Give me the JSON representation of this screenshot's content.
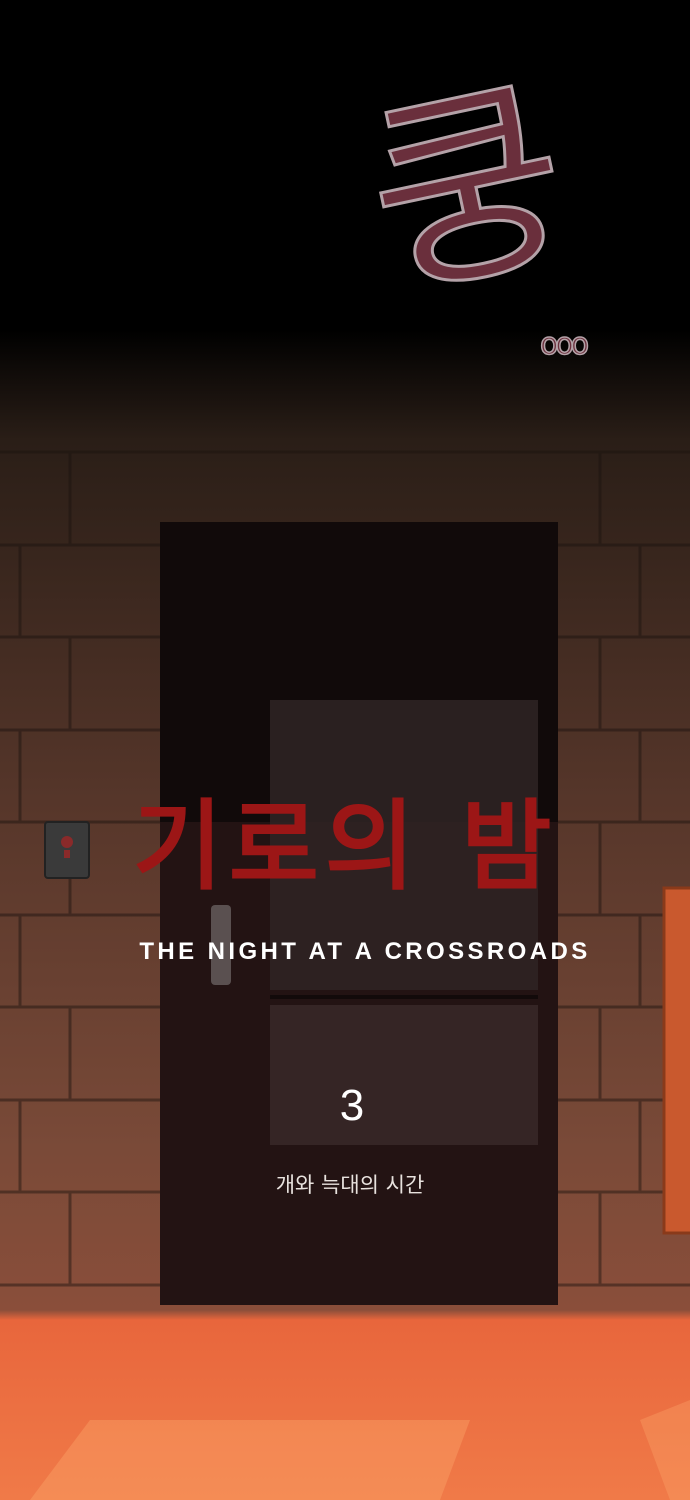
{
  "sound_effect": {
    "main": "쿵",
    "trail": "ooo"
  },
  "title": {
    "korean": "기로의 밤",
    "english": "THE NIGHT AT A CROSSROADS"
  },
  "episode": {
    "number": "3",
    "subtitle": "개와 늑대의 시간"
  },
  "colors": {
    "sfx_fill": "#6a2f3c",
    "sfx_outline": "#b4a2a8",
    "title_red": "#9c1616",
    "floor_orange": "#e8663c",
    "door": "#2a1616"
  },
  "icons": [
    "door-intercom-icon"
  ]
}
